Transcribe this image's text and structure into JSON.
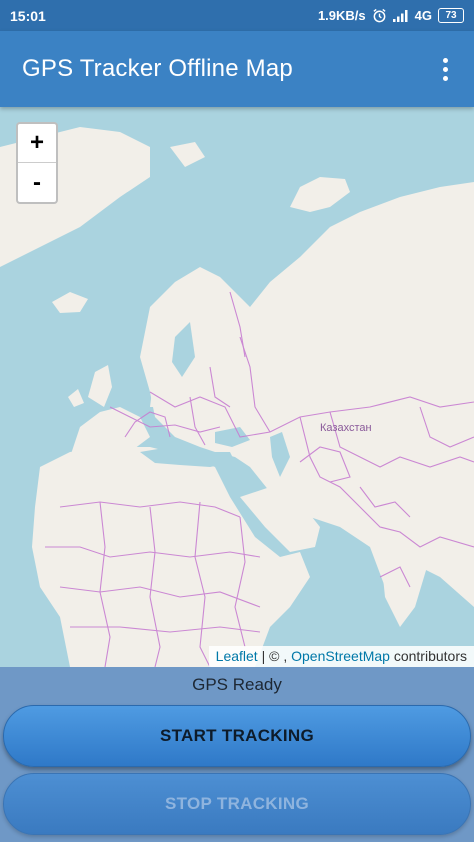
{
  "status_bar": {
    "time": "15:01",
    "network_speed": "1.9KB/s",
    "network_type": "4G",
    "battery": "73",
    "icons": [
      "alarm-icon",
      "signal-icon",
      "battery-icon"
    ]
  },
  "app_bar": {
    "title": "GPS Tracker Offline Map",
    "menu_icon": "overflow-menu-icon"
  },
  "map": {
    "zoom_in_label": "+",
    "zoom_out_label": "-",
    "country_label": "Казахстан",
    "attribution": {
      "leaflet": "Leaflet",
      "separator": "| © ,",
      "osm": "OpenStreetMap",
      "contributors": "contributors"
    },
    "colors": {
      "water": "#aad3df",
      "land": "#f2efe9",
      "border": "#c77dd1"
    }
  },
  "panel": {
    "gps_status": "GPS Ready",
    "start_label": "START TRACKING",
    "stop_label": "STOP TRACKING"
  },
  "colors": {
    "status_bar": "#2f6fad",
    "app_bar": "#3b82c4",
    "panel": "#6f98c6",
    "button": "#3a86d4"
  }
}
